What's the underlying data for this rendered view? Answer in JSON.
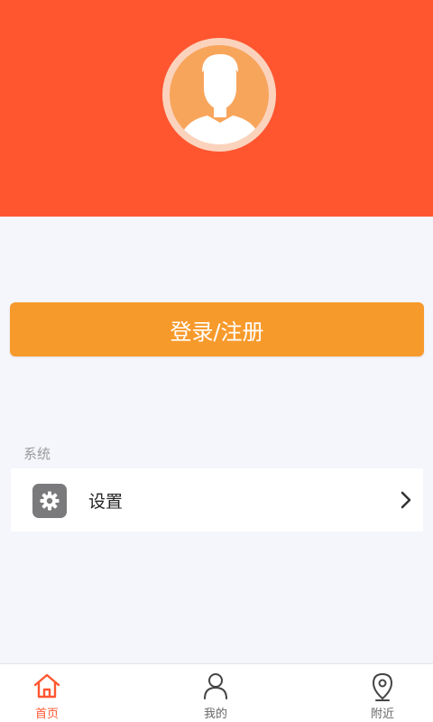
{
  "colors": {
    "header_bg": "#ff5630",
    "login_bg": "#f79a2c",
    "active_tab": "#ff5630",
    "page_bg": "#f5f6fc"
  },
  "header": {
    "avatar_icon": "user-avatar-icon"
  },
  "login": {
    "label": "登录/注册"
  },
  "section": {
    "title": "系统"
  },
  "menu": {
    "items": [
      {
        "label": "设置",
        "icon": "gear-icon",
        "trailing_icon": "chevron-right-icon"
      }
    ]
  },
  "tabbar": {
    "tabs": [
      {
        "label": "首页",
        "icon": "home-icon",
        "active": true
      },
      {
        "label": "我的",
        "icon": "user-icon",
        "active": false
      },
      {
        "label": "附近",
        "icon": "location-pin-icon",
        "active": false
      }
    ]
  }
}
